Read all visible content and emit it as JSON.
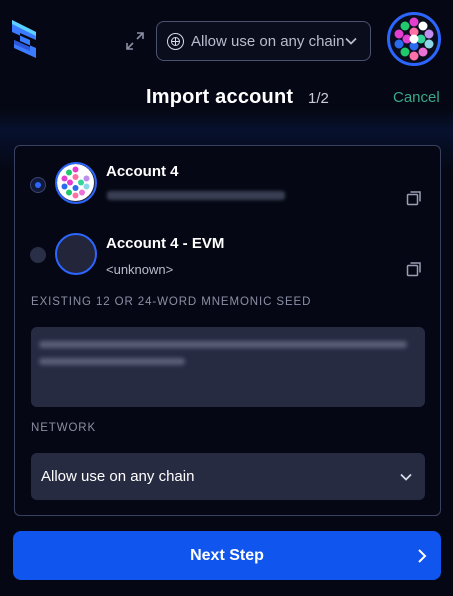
{
  "header": {
    "chain_selector": {
      "label": "Allow use on any chain",
      "icon": "chain-globe-icon"
    },
    "title": "Import account",
    "step": "1/2",
    "cancel_label": "Cancel"
  },
  "accounts": [
    {
      "name": "Account 4",
      "address_hidden": true,
      "selected": true
    },
    {
      "name": "Account 4 - EVM",
      "address": "<unknown>",
      "selected": false
    }
  ],
  "seed": {
    "label": "EXISTING 12 OR 24-WORD MNEMONIC SEED",
    "value_hidden": true
  },
  "network": {
    "label": "NETWORK",
    "value": "Allow use on any chain"
  },
  "primary_button": {
    "label": "Next Step"
  },
  "colors": {
    "accent": "#2d66ff",
    "button": "#0f55ee",
    "cancel": "#3aa889",
    "field_bg": "#272b42",
    "background": "#050814"
  }
}
